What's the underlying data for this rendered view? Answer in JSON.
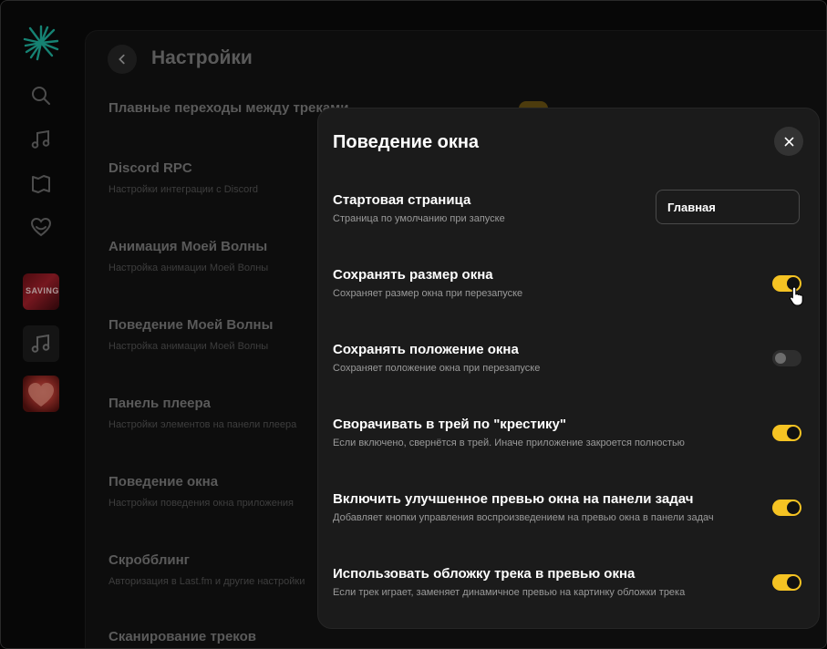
{
  "sidebar": {
    "nav": [
      "search-icon",
      "music-note-icon",
      "map-icon",
      "heart-icon"
    ],
    "playlists": [
      {
        "name": "playlist-cover-1",
        "text": "SAVING"
      },
      {
        "name": "playlist-music",
        "icon": "music-note-icon"
      },
      {
        "name": "playlist-cover-heart"
      }
    ]
  },
  "settings": {
    "title": "Настройки",
    "items": [
      {
        "title": "Плавные переходы между треками",
        "subtitle": ""
      },
      {
        "title": "Discord RPC",
        "subtitle": "Настройки интеграции с Discord"
      },
      {
        "title": "Анимация Моей Волны",
        "subtitle": "Настройка анимации Моей Волны"
      },
      {
        "title": "Поведение Моей Волны",
        "subtitle": "Настройка анимации Моей Волны"
      },
      {
        "title": "Панель плеера",
        "subtitle": "Настройки элементов на панели плеера"
      },
      {
        "title": "Поведение окна",
        "subtitle": "Настройки поведения окна приложения"
      },
      {
        "title": "Скробблинг",
        "subtitle": "Авторизация в Last.fm и другие настройки"
      },
      {
        "title": "Сканирование треков",
        "subtitle": ""
      }
    ]
  },
  "modal": {
    "title": "Поведение окна",
    "start_page": {
      "label": "Стартовая страница",
      "desc": "Страница по умолчанию при запуске",
      "value": "Главная"
    },
    "rows": [
      {
        "label": "Сохранять размер окна",
        "desc": "Сохраняет размер окна при перезапуске",
        "enabled": true
      },
      {
        "label": "Сохранять положение окна",
        "desc": "Сохраняет положение окна при перезапуске",
        "enabled": false
      },
      {
        "label": "Сворачивать в трей по \"крестику\"",
        "desc": "Если включено, свернётся в трей. Иначе приложение закроется полностью",
        "enabled": true
      },
      {
        "label": "Включить улучшенное превью окна на панели задач",
        "desc": "Добавляет кнопки управления воспроизведением на превью окна в панели задач",
        "enabled": true
      },
      {
        "label": "Использовать обложку трека в превью окна",
        "desc": "Если трек играет, заменяет динамичное превью на картинку обложки трека",
        "enabled": true
      }
    ]
  },
  "colors": {
    "accent": "#f5c323",
    "background": "#0b0b0b",
    "modal": "#1b1b1b"
  }
}
